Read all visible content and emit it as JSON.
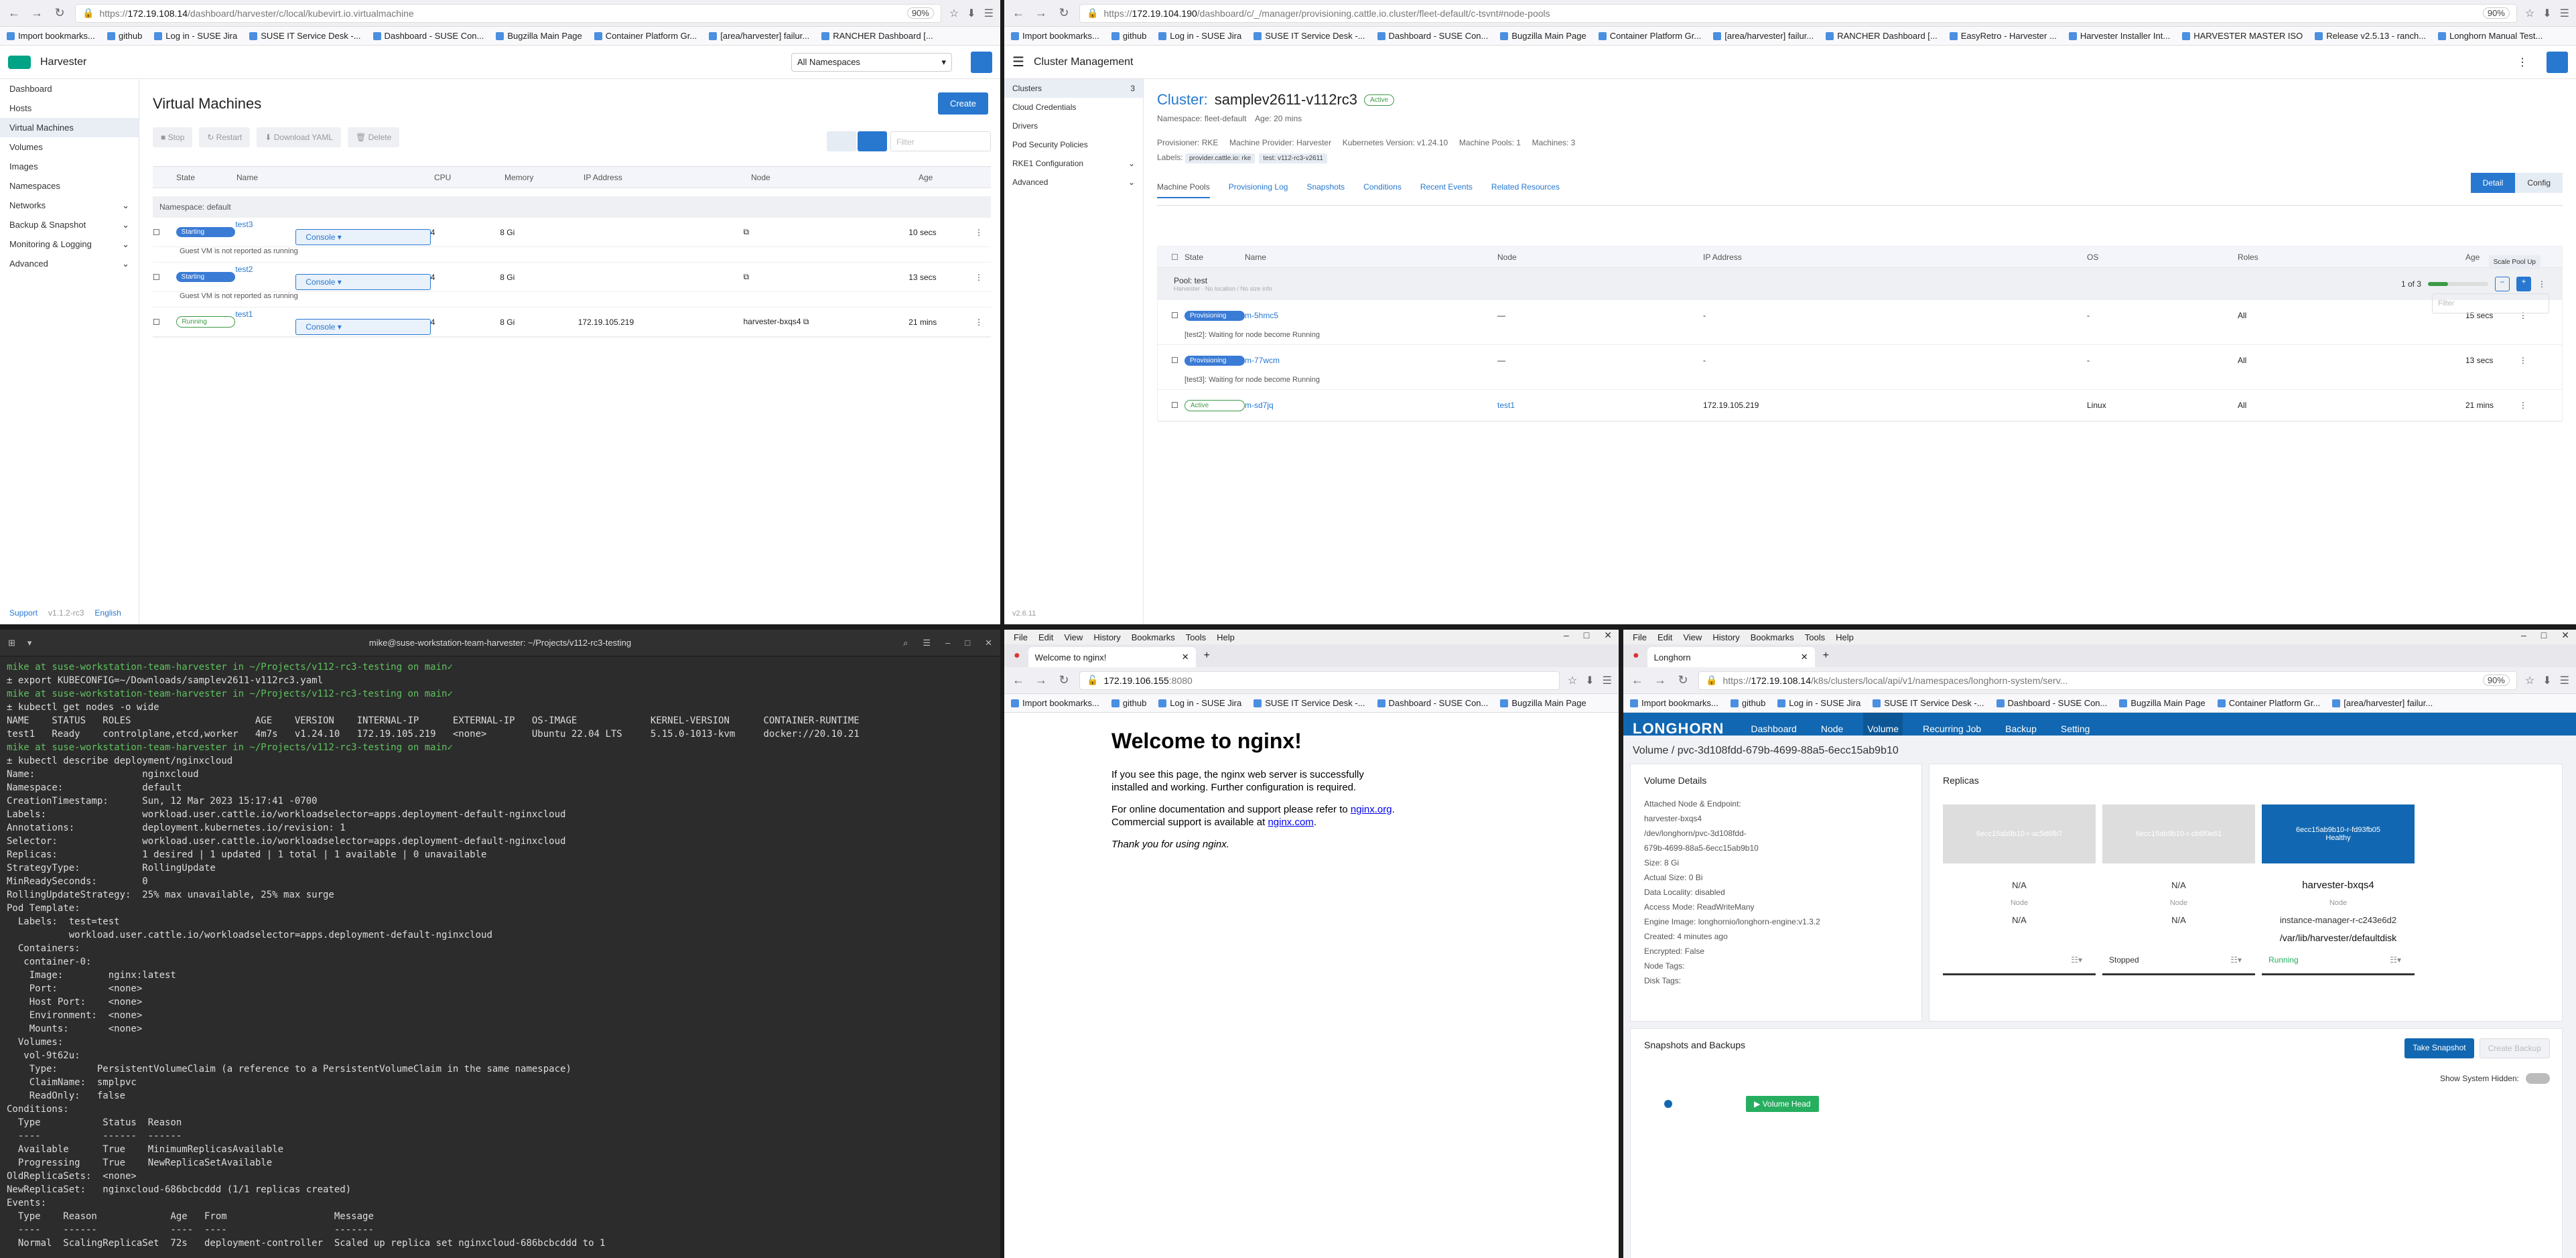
{
  "harvester": {
    "url_host": "172.19.108.14",
    "url_path": "/dashboard/harvester/c/local/kubevirt.io.virtualmachine",
    "zoom": "90%",
    "bookmarks": [
      "Import bookmarks...",
      "github",
      "Log in - SUSE Jira",
      "SUSE IT Service Desk -...",
      "Dashboard - SUSE Con...",
      "Bugzilla Main Page",
      "Container Platform Gr...",
      "[area/harvester] failur...",
      "RANCHER Dashboard [..."
    ],
    "brand": "Harvester",
    "namespace_select": "All Namespaces",
    "nav": [
      "Dashboard",
      "Hosts",
      "Virtual Machines",
      "Volumes",
      "Images",
      "Namespaces",
      "Networks",
      "Backup & Snapshot",
      "Monitoring & Logging",
      "Advanced"
    ],
    "footer": {
      "support": "Support",
      "version": "v1.1.2-rc3",
      "lang": "English"
    },
    "title": "Virtual Machines",
    "create": "Create",
    "actions": [
      "Stop",
      "Restart",
      "Download YAML",
      "Delete"
    ],
    "filter_placeholder": "Filter",
    "columns": [
      "State",
      "Name",
      "CPU",
      "Memory",
      "IP Address",
      "Node",
      "Age"
    ],
    "namespace_label": "Namespace: default",
    "vms": [
      {
        "state": "Starting",
        "name": "test3",
        "console": "Console",
        "cpu": "4",
        "mem": "8 Gi",
        "ip": "",
        "node": "",
        "age": "10 secs",
        "msg": "Guest VM is not reported as running"
      },
      {
        "state": "Starting",
        "name": "test2",
        "console": "Console",
        "cpu": "4",
        "mem": "8 Gi",
        "ip": "",
        "node": "",
        "age": "13 secs",
        "msg": "Guest VM is not reported as running"
      },
      {
        "state": "Running",
        "name": "test1",
        "console": "Console",
        "cpu": "4",
        "mem": "8 Gi",
        "ip": "172.19.105.219",
        "node": "harvester-bxqs4",
        "age": "21 mins",
        "msg": ""
      }
    ]
  },
  "rancher": {
    "url_host": "172.19.104.190",
    "url_path": "/dashboard/c/_/manager/provisioning.cattle.io.cluster/fleet-default/c-tsvnt#node-pools",
    "zoom": "90%",
    "bookmarks": [
      "Import bookmarks...",
      "github",
      "Log in - SUSE Jira",
      "SUSE IT Service Desk -...",
      "Dashboard - SUSE Con...",
      "Bugzilla Main Page",
      "Container Platform Gr...",
      "[area/harvester] failur...",
      "RANCHER Dashboard [...",
      "EasyRetro - Harvester ...",
      "Harvester Installer Int...",
      "HARVESTER MASTER ISO",
      "Release v2.5.13 - ranch...",
      "Longhorn Manual Test..."
    ],
    "header": "Cluster Management",
    "nav": [
      {
        "label": "Clusters",
        "count": "3"
      },
      {
        "label": "Cloud Credentials",
        "count": ""
      },
      {
        "label": "Drivers",
        "count": ""
      },
      {
        "label": "Pod Security Policies",
        "count": ""
      },
      {
        "label": "RKE1 Configuration",
        "count": ""
      },
      {
        "label": "Advanced",
        "count": ""
      }
    ],
    "version": "v2.6.11",
    "cluster_label": "Cluster:",
    "cluster_name": "samplev2611-v112rc3",
    "cluster_state": "Active",
    "namespace": "Namespace: fleet-default",
    "age": "Age: 20 mins",
    "provisioner": "Provisioner: RKE",
    "machine_provider": "Machine Provider: Harvester",
    "k8s_version": "Kubernetes Version: v1.24.10",
    "machine_pools": "Machine Pools: 1",
    "machines": "Machines: 3",
    "labels_label": "Labels:",
    "labels": [
      "provider.cattle.io: rke",
      "test: v112-rc3-v2611"
    ],
    "detail_btn": "Detail",
    "config_btn": "Config",
    "tabs": [
      "Machine Pools",
      "Provisioning Log",
      "Snapshots",
      "Conditions",
      "Recent Events",
      "Related Resources"
    ],
    "filter_placeholder": "Filter",
    "columns": [
      "State",
      "Name",
      "Node",
      "IP Address",
      "OS",
      "Roles",
      "Age"
    ],
    "scale_tip": "Scale Pool Up",
    "pool_name": "Pool: test",
    "pool_sub": "Harvester · No location / No size info",
    "pool_count": "1 of 3",
    "pool_progress": 0.33,
    "machines_list": [
      {
        "state": "Provisioning",
        "name": "m-5hmc5",
        "node": "—",
        "ip": "-",
        "os": "-",
        "roles": "All",
        "age": "15 secs",
        "msg": "[test2]: Waiting for node become Running"
      },
      {
        "state": "Provisioning",
        "name": "m-77wcm",
        "node": "—",
        "ip": "-",
        "os": "-",
        "roles": "All",
        "age": "13 secs",
        "msg": "[test3]: Waiting for node become Running"
      },
      {
        "state": "Active",
        "name": "m-sd7jq",
        "node": "test1",
        "ip": "172.19.105.219",
        "os": "Linux",
        "roles": "All",
        "age": "21 mins",
        "msg": ""
      }
    ]
  },
  "terminal": {
    "title": "mike@suse-workstation-team-harvester: ~/Projects/v112-rc3-testing",
    "lines": [
      {
        "t": "mike at suse-workstation-team-harvester in ~/Projects/v112-rc3-testing on main✓",
        "k": "prompt"
      },
      {
        "t": "± export KUBECONFIG=~/Downloads/samplev2611-v112rc3.yaml",
        "k": ""
      },
      {
        "t": "mike at suse-workstation-team-harvester in ~/Projects/v112-rc3-testing on main✓",
        "k": "prompt"
      },
      {
        "t": "± kubectl get nodes -o wide",
        "k": ""
      },
      {
        "t": "NAME    STATUS   ROLES                      AGE    VERSION    INTERNAL-IP      EXTERNAL-IP   OS-IMAGE             KERNEL-VERSION      CONTAINER-RUNTIME",
        "k": ""
      },
      {
        "t": "test1   Ready    controlplane,etcd,worker   4m7s   v1.24.10   172.19.105.219   <none>        Ubuntu 22.04 LTS     5.15.0-1013-kvm     docker://20.10.21",
        "k": ""
      },
      {
        "t": "mike at suse-workstation-team-harvester in ~/Projects/v112-rc3-testing on main✓",
        "k": "prompt"
      },
      {
        "t": "± kubectl describe deployment/nginxcloud",
        "k": ""
      },
      {
        "t": "Name:                   nginxcloud",
        "k": ""
      },
      {
        "t": "Namespace:              default",
        "k": ""
      },
      {
        "t": "CreationTimestamp:      Sun, 12 Mar 2023 15:17:41 -0700",
        "k": ""
      },
      {
        "t": "Labels:                 workload.user.cattle.io/workloadselector=apps.deployment-default-nginxcloud",
        "k": ""
      },
      {
        "t": "Annotations:            deployment.kubernetes.io/revision: 1",
        "k": ""
      },
      {
        "t": "Selector:               workload.user.cattle.io/workloadselector=apps.deployment-default-nginxcloud",
        "k": ""
      },
      {
        "t": "Replicas:               1 desired | 1 updated | 1 total | 1 available | 0 unavailable",
        "k": ""
      },
      {
        "t": "StrategyType:           RollingUpdate",
        "k": ""
      },
      {
        "t": "MinReadySeconds:        0",
        "k": ""
      },
      {
        "t": "RollingUpdateStrategy:  25% max unavailable, 25% max surge",
        "k": ""
      },
      {
        "t": "Pod Template:",
        "k": ""
      },
      {
        "t": "  Labels:  test=test",
        "k": ""
      },
      {
        "t": "           workload.user.cattle.io/workloadselector=apps.deployment-default-nginxcloud",
        "k": ""
      },
      {
        "t": "  Containers:",
        "k": ""
      },
      {
        "t": "   container-0:",
        "k": ""
      },
      {
        "t": "    Image:        nginx:latest",
        "k": ""
      },
      {
        "t": "    Port:         <none>",
        "k": ""
      },
      {
        "t": "    Host Port:    <none>",
        "k": ""
      },
      {
        "t": "    Environment:  <none>",
        "k": ""
      },
      {
        "t": "    Mounts:       <none>",
        "k": ""
      },
      {
        "t": "  Volumes:",
        "k": ""
      },
      {
        "t": "   vol-9t62u:",
        "k": ""
      },
      {
        "t": "    Type:       PersistentVolumeClaim (a reference to a PersistentVolumeClaim in the same namespace)",
        "k": ""
      },
      {
        "t": "    ClaimName:  smplpvc",
        "k": ""
      },
      {
        "t": "    ReadOnly:   false",
        "k": ""
      },
      {
        "t": "Conditions:",
        "k": ""
      },
      {
        "t": "  Type           Status  Reason",
        "k": ""
      },
      {
        "t": "  ----           ------  ------",
        "k": ""
      },
      {
        "t": "  Available      True    MinimumReplicasAvailable",
        "k": ""
      },
      {
        "t": "  Progressing    True    NewReplicaSetAvailable",
        "k": ""
      },
      {
        "t": "OldReplicaSets:  <none>",
        "k": ""
      },
      {
        "t": "NewReplicaSet:   nginxcloud-686bcbcddd (1/1 replicas created)",
        "k": ""
      },
      {
        "t": "Events:",
        "k": ""
      },
      {
        "t": "  Type    Reason             Age   From                   Message",
        "k": ""
      },
      {
        "t": "  ----    ------             ----  ----                   -------",
        "k": ""
      },
      {
        "t": "  Normal  ScalingReplicaSet  72s   deployment-controller  Scaled up replica set nginxcloud-686bcbcddd to 1",
        "k": ""
      }
    ]
  },
  "nginx_browser": {
    "menu": [
      "File",
      "Edit",
      "View",
      "History",
      "Bookmarks",
      "Tools",
      "Help"
    ],
    "tab_title": "Welcome to nginx!",
    "url_host": "172.19.106.155",
    "url_path": ":8080",
    "bookmarks": [
      "Import bookmarks...",
      "github",
      "Log in - SUSE Jira",
      "SUSE IT Service Desk -...",
      "Dashboard - SUSE Con...",
      "Bugzilla Main Page"
    ],
    "heading": "Welcome to nginx!",
    "p1": "If you see this page, the nginx web server is successfully installed and working. Further configuration is required.",
    "p2a": "For online documentation and support please refer to ",
    "link1": "nginx.org",
    "p2b": ".",
    "p2c": "Commercial support is available at ",
    "link2": "nginx.com",
    "p2d": ".",
    "p3": "Thank you for using nginx."
  },
  "longhorn_browser": {
    "menu": [
      "File",
      "Edit",
      "View",
      "History",
      "Bookmarks",
      "Tools",
      "Help"
    ],
    "tab_title": "Longhorn",
    "url_host": "172.19.108.14",
    "url_path": "/k8s/clusters/local/api/v1/namespaces/longhorn-system/serv...",
    "zoom": "90%",
    "bookmarks": [
      "Import bookmarks...",
      "github",
      "Log in - SUSE Jira",
      "SUSE IT Service Desk -...",
      "Dashboard - SUSE Con...",
      "Bugzilla Main Page",
      "Container Platform Gr...",
      "[area/harvester] failur..."
    ],
    "logo": "LONGHORN",
    "nav": [
      "Dashboard",
      "Node",
      "Volume",
      "Recurring Job",
      "Backup",
      "Setting"
    ],
    "breadcrumb_root": "Volume",
    "breadcrumb_vol": "pvc-3d108fdd-679b-4699-88a5-6ecc15ab9b10",
    "details_title": "Volume Details",
    "details": [
      "Attached Node & Endpoint:",
      "harvester-bxqs4",
      "/dev/longhorn/pvc-3d108fdd-",
      "679b-4699-88a5-6ecc15ab9b10",
      "Size:  8 Gi",
      "Actual Size:  0 Bi",
      "Data Locality:  disabled",
      "Access Mode:  ReadWriteMany",
      "Engine Image:  longhornio/longhorn-engine:v1.3.2",
      "Created:  4 minutes ago",
      "Encrypted:  False",
      "Node Tags:",
      "Disk Tags:"
    ],
    "replicas_title": "Replicas",
    "replicas": [
      {
        "id": "6ecc15ab9b10-r-ac5d6fb7",
        "a": "N/A",
        "b": "Node",
        "c": "N/A",
        "status": "",
        "on": false
      },
      {
        "id": "6ecc15ab9b10-r-cb6f0e61",
        "a": "N/A",
        "b": "Node",
        "c": "N/A",
        "status": "Stopped",
        "on": false
      },
      {
        "id": "6ecc15ab9b10-r-fd93fb05",
        "a": "harvester-bxqs4",
        "b": "Node",
        "c": "instance-manager-r-c243e6d2",
        "path": "/var/lib/harvester/defaultdisk",
        "status": "Running",
        "on": true,
        "health": "Healthy"
      }
    ],
    "snap_title": "Snapshots and Backups",
    "take_snapshot": "Take Snapshot",
    "create_backup": "Create Backup",
    "show_hidden": "Show System Hidden:",
    "volume_head": "Volume Head"
  }
}
